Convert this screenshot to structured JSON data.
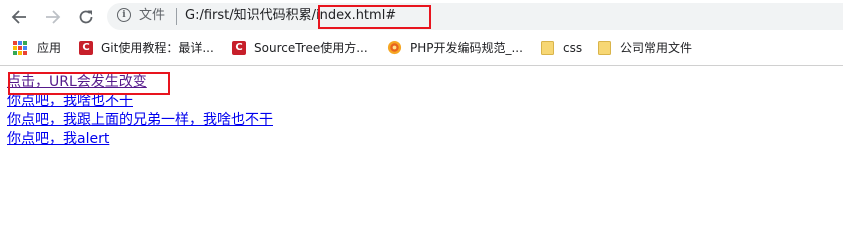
{
  "browser": {
    "nav": {
      "back_icon": "arrow-left-icon",
      "forward_icon": "arrow-right-icon",
      "reload_icon": "reload-icon"
    },
    "omnibox": {
      "info_icon": "info-icon",
      "file_label": "文件",
      "url": "G:/first/知识代码积累/index.html#"
    }
  },
  "bookmarks": [
    {
      "label": "应用",
      "icon": "apps-grid-icon"
    },
    {
      "label": "Git使用教程：最详...",
      "icon": "csdn-icon"
    },
    {
      "label": "SourceTree使用方...",
      "icon": "csdn-icon"
    },
    {
      "label": "PHP开发编码规范_...",
      "icon": "php-icon"
    },
    {
      "label": "css",
      "icon": "folder-icon"
    },
    {
      "label": "公司常用文件",
      "icon": "folder-icon"
    }
  ],
  "page": {
    "links": [
      "点击，URL会发生改变",
      "你点吧，我啥也不干",
      "你点吧，我跟上面的兄弟一样，我啥也不干",
      "你点吧，我alert"
    ]
  },
  "colors": {
    "highlight_box": "#e8141e",
    "visited_link": "#551a8b",
    "link": "#0000ee"
  }
}
